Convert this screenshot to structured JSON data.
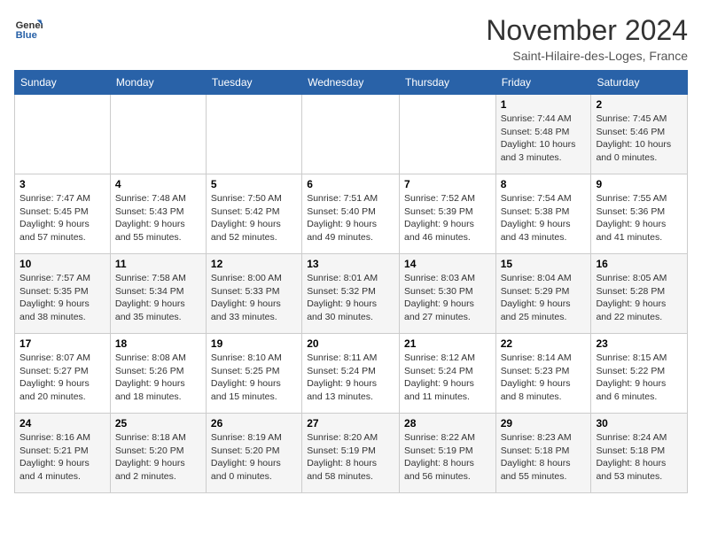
{
  "header": {
    "logo_line1": "General",
    "logo_line2": "Blue",
    "month_title": "November 2024",
    "location": "Saint-Hilaire-des-Loges, France"
  },
  "weekdays": [
    "Sunday",
    "Monday",
    "Tuesday",
    "Wednesday",
    "Thursday",
    "Friday",
    "Saturday"
  ],
  "weeks": [
    [
      {
        "day": "",
        "info": ""
      },
      {
        "day": "",
        "info": ""
      },
      {
        "day": "",
        "info": ""
      },
      {
        "day": "",
        "info": ""
      },
      {
        "day": "",
        "info": ""
      },
      {
        "day": "1",
        "info": "Sunrise: 7:44 AM\nSunset: 5:48 PM\nDaylight: 10 hours\nand 3 minutes."
      },
      {
        "day": "2",
        "info": "Sunrise: 7:45 AM\nSunset: 5:46 PM\nDaylight: 10 hours\nand 0 minutes."
      }
    ],
    [
      {
        "day": "3",
        "info": "Sunrise: 7:47 AM\nSunset: 5:45 PM\nDaylight: 9 hours\nand 57 minutes."
      },
      {
        "day": "4",
        "info": "Sunrise: 7:48 AM\nSunset: 5:43 PM\nDaylight: 9 hours\nand 55 minutes."
      },
      {
        "day": "5",
        "info": "Sunrise: 7:50 AM\nSunset: 5:42 PM\nDaylight: 9 hours\nand 52 minutes."
      },
      {
        "day": "6",
        "info": "Sunrise: 7:51 AM\nSunset: 5:40 PM\nDaylight: 9 hours\nand 49 minutes."
      },
      {
        "day": "7",
        "info": "Sunrise: 7:52 AM\nSunset: 5:39 PM\nDaylight: 9 hours\nand 46 minutes."
      },
      {
        "day": "8",
        "info": "Sunrise: 7:54 AM\nSunset: 5:38 PM\nDaylight: 9 hours\nand 43 minutes."
      },
      {
        "day": "9",
        "info": "Sunrise: 7:55 AM\nSunset: 5:36 PM\nDaylight: 9 hours\nand 41 minutes."
      }
    ],
    [
      {
        "day": "10",
        "info": "Sunrise: 7:57 AM\nSunset: 5:35 PM\nDaylight: 9 hours\nand 38 minutes."
      },
      {
        "day": "11",
        "info": "Sunrise: 7:58 AM\nSunset: 5:34 PM\nDaylight: 9 hours\nand 35 minutes."
      },
      {
        "day": "12",
        "info": "Sunrise: 8:00 AM\nSunset: 5:33 PM\nDaylight: 9 hours\nand 33 minutes."
      },
      {
        "day": "13",
        "info": "Sunrise: 8:01 AM\nSunset: 5:32 PM\nDaylight: 9 hours\nand 30 minutes."
      },
      {
        "day": "14",
        "info": "Sunrise: 8:03 AM\nSunset: 5:30 PM\nDaylight: 9 hours\nand 27 minutes."
      },
      {
        "day": "15",
        "info": "Sunrise: 8:04 AM\nSunset: 5:29 PM\nDaylight: 9 hours\nand 25 minutes."
      },
      {
        "day": "16",
        "info": "Sunrise: 8:05 AM\nSunset: 5:28 PM\nDaylight: 9 hours\nand 22 minutes."
      }
    ],
    [
      {
        "day": "17",
        "info": "Sunrise: 8:07 AM\nSunset: 5:27 PM\nDaylight: 9 hours\nand 20 minutes."
      },
      {
        "day": "18",
        "info": "Sunrise: 8:08 AM\nSunset: 5:26 PM\nDaylight: 9 hours\nand 18 minutes."
      },
      {
        "day": "19",
        "info": "Sunrise: 8:10 AM\nSunset: 5:25 PM\nDaylight: 9 hours\nand 15 minutes."
      },
      {
        "day": "20",
        "info": "Sunrise: 8:11 AM\nSunset: 5:24 PM\nDaylight: 9 hours\nand 13 minutes."
      },
      {
        "day": "21",
        "info": "Sunrise: 8:12 AM\nSunset: 5:24 PM\nDaylight: 9 hours\nand 11 minutes."
      },
      {
        "day": "22",
        "info": "Sunrise: 8:14 AM\nSunset: 5:23 PM\nDaylight: 9 hours\nand 8 minutes."
      },
      {
        "day": "23",
        "info": "Sunrise: 8:15 AM\nSunset: 5:22 PM\nDaylight: 9 hours\nand 6 minutes."
      }
    ],
    [
      {
        "day": "24",
        "info": "Sunrise: 8:16 AM\nSunset: 5:21 PM\nDaylight: 9 hours\nand 4 minutes."
      },
      {
        "day": "25",
        "info": "Sunrise: 8:18 AM\nSunset: 5:20 PM\nDaylight: 9 hours\nand 2 minutes."
      },
      {
        "day": "26",
        "info": "Sunrise: 8:19 AM\nSunset: 5:20 PM\nDaylight: 9 hours\nand 0 minutes."
      },
      {
        "day": "27",
        "info": "Sunrise: 8:20 AM\nSunset: 5:19 PM\nDaylight: 8 hours\nand 58 minutes."
      },
      {
        "day": "28",
        "info": "Sunrise: 8:22 AM\nSunset: 5:19 PM\nDaylight: 8 hours\nand 56 minutes."
      },
      {
        "day": "29",
        "info": "Sunrise: 8:23 AM\nSunset: 5:18 PM\nDaylight: 8 hours\nand 55 minutes."
      },
      {
        "day": "30",
        "info": "Sunrise: 8:24 AM\nSunset: 5:18 PM\nDaylight: 8 hours\nand 53 minutes."
      }
    ]
  ]
}
